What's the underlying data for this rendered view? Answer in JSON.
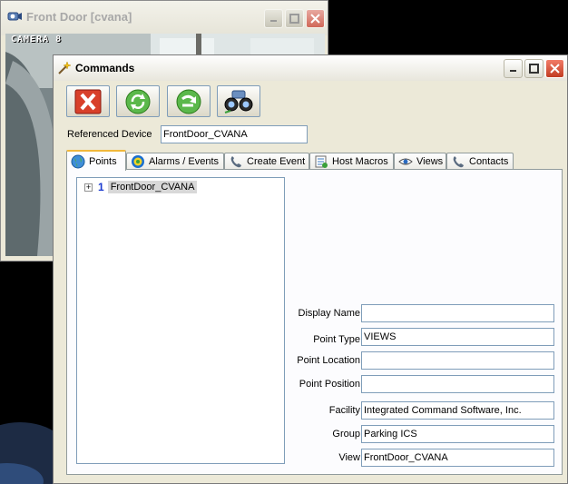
{
  "camera_window": {
    "title": "Front Door [cvana]",
    "overlay_label": "CAMERA 8"
  },
  "commands_window": {
    "title": "Commands",
    "toolbar": [
      {
        "name": "close-command-button",
        "icon": "red-x-icon"
      },
      {
        "name": "refresh-button",
        "icon": "green-refresh-icon"
      },
      {
        "name": "execute-button",
        "icon": "green-arrow-icon"
      },
      {
        "name": "binoculars-button",
        "icon": "binoculars-icon"
      }
    ],
    "referenced_device": {
      "label": "Referenced Device",
      "value": "FrontDoor_CVANA"
    },
    "tabs": [
      {
        "label": "Points",
        "icon": "globe-icon"
      },
      {
        "label": "Alarms / Events",
        "icon": "alarm-icon"
      },
      {
        "label": "Create Event",
        "icon": "phone-icon"
      },
      {
        "label": "Host Macros",
        "icon": "macro-icon"
      },
      {
        "label": "Views",
        "icon": "eye-icon"
      },
      {
        "label": "Contacts",
        "icon": "phone-icon"
      }
    ],
    "tree": {
      "node_label": "FrontDoor_CVANA",
      "node_index": "1"
    },
    "properties": [
      {
        "label": "Display Name",
        "value": ""
      },
      {
        "label": "Point Type",
        "value": "VIEWS"
      },
      {
        "label": "Point Location",
        "value": ""
      },
      {
        "label": "Point Position",
        "value": ""
      },
      {
        "label": "Facility",
        "value": "Integrated Command Software, Inc."
      },
      {
        "label": "Group",
        "value": "Parking ICS"
      },
      {
        "label": "View",
        "value": "FrontDoor_CVANA"
      }
    ]
  },
  "colors": {
    "desktop": "#000000",
    "window_face": "#ece9d8",
    "active_tab_accent": "#f1b83c",
    "close_red": "#d8402a"
  }
}
